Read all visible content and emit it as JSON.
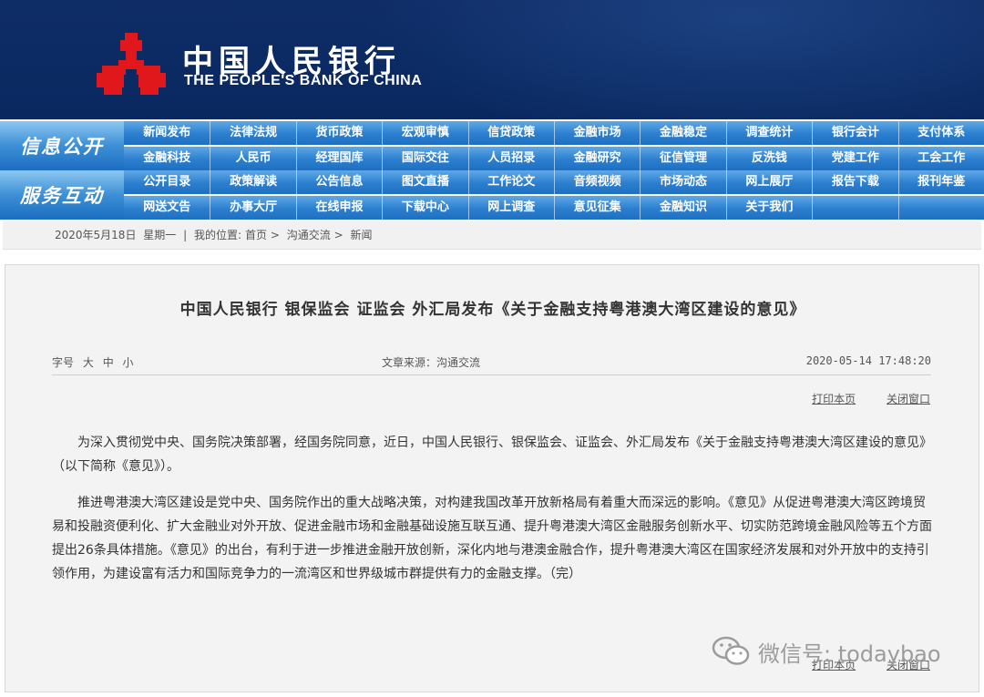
{
  "header": {
    "bank_name_cn": "中国人民银行",
    "bank_name_en": "THE PEOPLE'S BANK OF CHINA",
    "logo_icon": "pboc-logo-icon",
    "bg_color": "#0b2a63",
    "logo_color": "#e1181b"
  },
  "nav": {
    "section1": {
      "label": "信息公开",
      "row1": [
        "新闻发布",
        "法律法规",
        "货币政策",
        "宏观审慎",
        "信贷政策",
        "金融市场",
        "金融稳定",
        "调查统计",
        "银行会计",
        "支付体系"
      ],
      "row2": [
        "金融科技",
        "人民币",
        "经理国库",
        "国际交往",
        "人员招录",
        "金融研究",
        "征信管理",
        "反洗钱",
        "党建工作",
        "工会工作"
      ]
    },
    "section2": {
      "label": "服务互动",
      "row1": [
        "公开目录",
        "政策解读",
        "公告信息",
        "图文直播",
        "工作论文",
        "音频视频",
        "市场动态",
        "网上展厅",
        "报告下载",
        "报刊年鉴"
      ],
      "row2": [
        "网送文告",
        "办事大厅",
        "在线申报",
        "下载中心",
        "网上调查",
        "意见征集",
        "金融知识",
        "关于我们",
        "",
        ""
      ]
    },
    "accent_color": "#2b7fcf"
  },
  "breadcrumb": {
    "date": "2020年5月18日",
    "weekday": "星期一",
    "sep": "|",
    "location_label": "我的位置:",
    "items": [
      "首页",
      "沟通交流",
      "新闻"
    ],
    "arrow": ">"
  },
  "article": {
    "title": "中国人民银行 银保监会 证监会 外汇局发布《关于金融支持粤港澳大湾区建设的意见》",
    "font_size_label": "字号",
    "font_sizes": [
      "大",
      "中",
      "小"
    ],
    "source": "文章来源：沟通交流",
    "datetime": "2020-05-14 17:48:20",
    "print_label": "打印本页",
    "close_label": "关闭窗口",
    "paragraphs": [
      "为深入贯彻党中央、国务院决策部署，经国务院同意，近日，中国人民银行、银保监会、证监会、外汇局发布《关于金融支持粤港澳大湾区建设的意见》（以下简称《意见》）。",
      "推进粤港澳大湾区建设是党中央、国务院作出的重大战略决策，对构建我国改革开放新格局有着重大而深远的影响。《意见》从促进粤港澳大湾区跨境贸易和投融资便利化、扩大金融业对外开放、促进金融市场和金融基础设施互联互通、提升粤港澳大湾区金融服务创新水平、切实防范跨境金融风险等五个方面提出26条具体措施。《意见》的出台，有利于进一步推进金融开放创新，深化内地与港澳金融合作，提升粤港澳大湾区在国家经济发展和对外开放中的支持引领作用，为建设富有活力和国际竞争力的一流湾区和世界级城市群提供有力的金融支撑。（完）"
    ]
  },
  "watermark": {
    "text": "微信号: todaybao",
    "icon": "wechat-icon"
  }
}
